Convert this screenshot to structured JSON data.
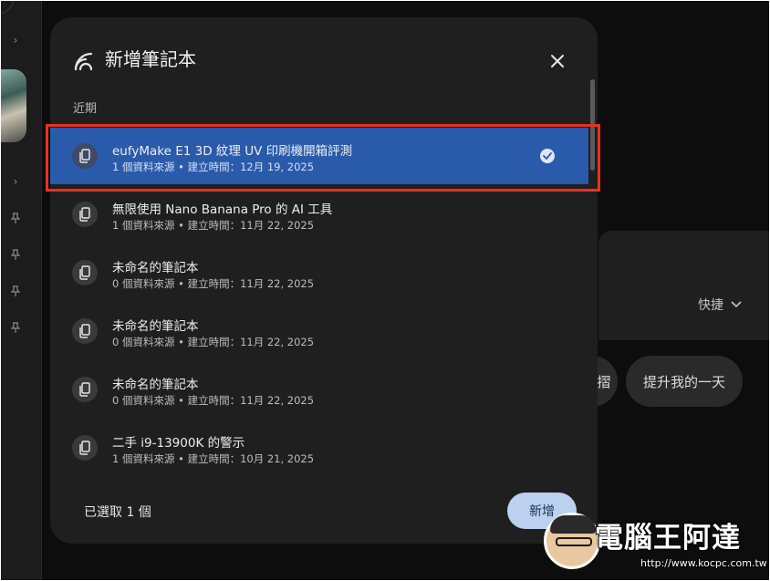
{
  "dialog": {
    "title": "新增筆記本",
    "close_icon": "close-icon",
    "section_label": "近期",
    "notebooks": [
      {
        "title": "eufyMake E1 3D 紋理 UV 印刷機開箱評測",
        "meta": "1 個資料來源 • 建立時間：12月 19, 2025",
        "selected": true
      },
      {
        "title": "無限使用 Nano Banana Pro 的 AI 工具",
        "meta": "1 個資料來源 • 建立時間：11月 22, 2025",
        "selected": false
      },
      {
        "title": "未命名的筆記本",
        "meta": "0 個資料來源 • 建立時間：11月 22, 2025",
        "selected": false
      },
      {
        "title": "未命名的筆記本",
        "meta": "0 個資料來源 • 建立時間：11月 22, 2025",
        "selected": false
      },
      {
        "title": "未命名的筆記本",
        "meta": "0 個資料來源 • 建立時間：11月 22, 2025",
        "selected": false
      },
      {
        "title": "二手 i9-13900K 的警示",
        "meta": "1 個資料來源 • 建立時間：10月 21, 2025",
        "selected": false
      }
    ],
    "footer": {
      "selected_count": "已選取 1 個",
      "add_label": "新增"
    }
  },
  "background": {
    "quick_label": "快捷",
    "chip_partial": "摺",
    "chip_label": "提升我的一天"
  },
  "watermark": {
    "title": "電腦王阿達",
    "url": "http://www.kocpc.com.tw"
  },
  "colors": {
    "accent_selected": "#2a5bab",
    "highlight": "#e8321e",
    "add_button": "#bcd0ef",
    "dialog_bg": "#1f1f1f"
  }
}
